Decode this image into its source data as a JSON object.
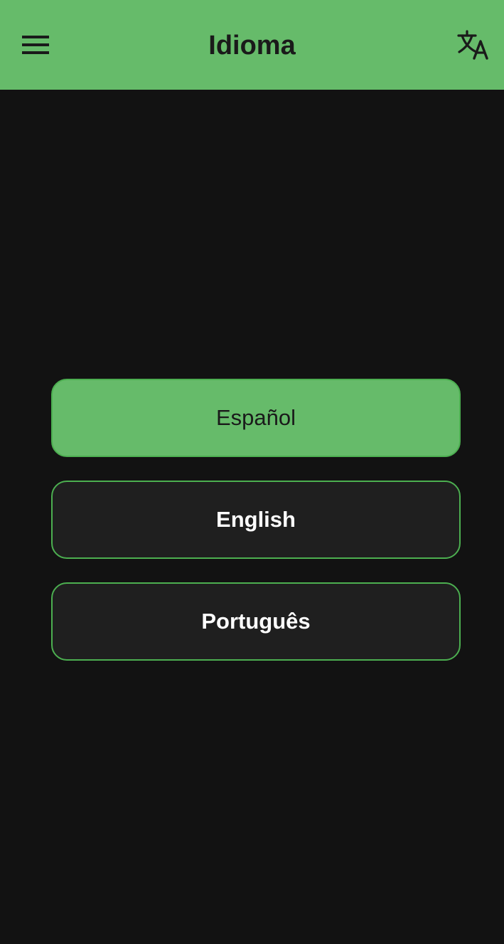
{
  "app_bar": {
    "title": "Idioma",
    "menu_icon": "hamburger-menu-icon",
    "translate_icon": "translate-icon"
  },
  "languages": [
    {
      "label": "Español",
      "selected": true
    },
    {
      "label": "English",
      "selected": false
    },
    {
      "label": "Português",
      "selected": false
    }
  ],
  "colors": {
    "primary": "#66bb6a",
    "primary_border": "#4caf50",
    "background": "#121212",
    "surface": "#1f1f1f",
    "on_primary": "#1a1a1a",
    "on_surface": "#ffffff"
  }
}
